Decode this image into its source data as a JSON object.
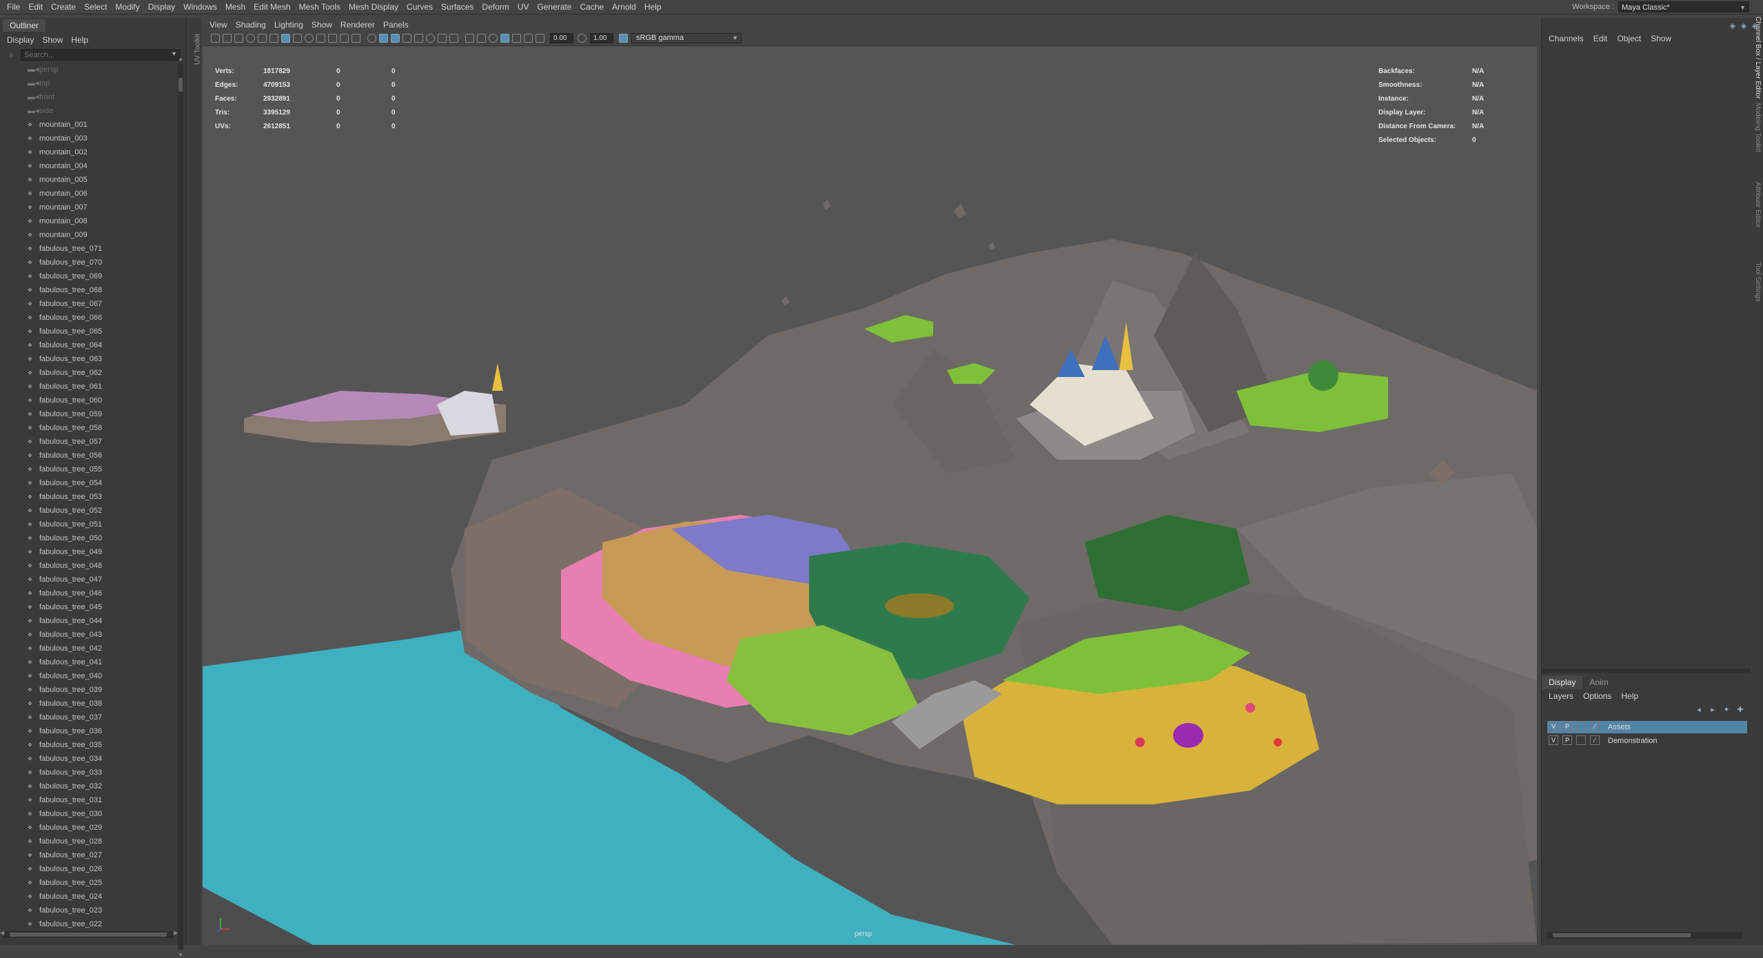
{
  "menubar": [
    "File",
    "Edit",
    "Create",
    "Select",
    "Modify",
    "Display",
    "Windows",
    "Mesh",
    "Edit Mesh",
    "Mesh Tools",
    "Mesh Display",
    "Curves",
    "Surfaces",
    "Deform",
    "UV",
    "Generate",
    "Cache",
    "Arnold",
    "Help"
  ],
  "workspace": {
    "label": "Workspace :",
    "value": "Maya Classic*"
  },
  "outliner": {
    "title": "Outliner",
    "menu": [
      "Display",
      "Show",
      "Help"
    ],
    "search_placeholder": "Search...",
    "items": [
      "persp",
      "top",
      "front",
      "side",
      "mountain_001",
      "mountain_003",
      "mountain_002",
      "mountain_004",
      "mountain_005",
      "mountain_006",
      "mountain_007",
      "mountain_008",
      "mountain_009",
      "fabulous_tree_071",
      "fabulous_tree_070",
      "fabulous_tree_069",
      "fabulous_tree_068",
      "fabulous_tree_067",
      "fabulous_tree_066",
      "fabulous_tree_065",
      "fabulous_tree_064",
      "fabulous_tree_063",
      "fabulous_tree_062",
      "fabulous_tree_061",
      "fabulous_tree_060",
      "fabulous_tree_059",
      "fabulous_tree_058",
      "fabulous_tree_057",
      "fabulous_tree_056",
      "fabulous_tree_055",
      "fabulous_tree_054",
      "fabulous_tree_053",
      "fabulous_tree_052",
      "fabulous_tree_051",
      "fabulous_tree_050",
      "fabulous_tree_049",
      "fabulous_tree_048",
      "fabulous_tree_047",
      "fabulous_tree_046",
      "fabulous_tree_045",
      "fabulous_tree_044",
      "fabulous_tree_043",
      "fabulous_tree_042",
      "fabulous_tree_041",
      "fabulous_tree_040",
      "fabulous_tree_039",
      "fabulous_tree_038",
      "fabulous_tree_037",
      "fabulous_tree_036",
      "fabulous_tree_035",
      "fabulous_tree_034",
      "fabulous_tree_033",
      "fabulous_tree_032",
      "fabulous_tree_031",
      "fabulous_tree_030",
      "fabulous_tree_029",
      "fabulous_tree_028",
      "fabulous_tree_027",
      "fabulous_tree_026",
      "fabulous_tree_025",
      "fabulous_tree_024",
      "fabulous_tree_023",
      "fabulous_tree_022"
    ],
    "camera_count": 4
  },
  "uv_toolkit_label": "UV Toolkit",
  "viewport": {
    "menu": [
      "View",
      "Shading",
      "Lighting",
      "Show",
      "Renderer",
      "Panels"
    ],
    "exposure": "0.00",
    "gamma": "1.00",
    "color_space": "sRGB gamma",
    "stats": [
      {
        "label": "Verts:",
        "v1": "1817829",
        "v2": "0",
        "v3": "0"
      },
      {
        "label": "Edges:",
        "v1": "4709153",
        "v2": "0",
        "v3": "0"
      },
      {
        "label": "Faces:",
        "v1": "2932891",
        "v2": "0",
        "v3": "0"
      },
      {
        "label": "Tris:",
        "v1": "3395129",
        "v2": "0",
        "v3": "0"
      },
      {
        "label": "UVs:",
        "v1": "2612851",
        "v2": "0",
        "v3": "0"
      }
    ],
    "info": [
      {
        "label": "Backfaces:",
        "value": "N/A"
      },
      {
        "label": "Smoothness:",
        "value": "N/A"
      },
      {
        "label": "Instance:",
        "value": "N/A"
      },
      {
        "label": "Display Layer:",
        "value": "N/A"
      },
      {
        "label": "Distance From Camera:",
        "value": "N/A"
      },
      {
        "label": "Selected Objects:",
        "value": "0"
      }
    ],
    "camera": "persp",
    "colors": {
      "water": "#3fb0c0",
      "rock": "#6e6a68",
      "grass": "#7fc03a",
      "pink": "#e77fb0",
      "sand": "#d8b23a"
    }
  },
  "channel_box": {
    "menu": [
      "Channels",
      "Edit",
      "Object",
      "Show"
    ]
  },
  "layer_editor": {
    "tabs": [
      "Display",
      "Anim"
    ],
    "menu": [
      "Layers",
      "Options",
      "Help"
    ],
    "layers": [
      {
        "v": "V",
        "p": "P",
        "name": "Assets",
        "selected": true
      },
      {
        "v": "V",
        "p": "P",
        "name": "Demonstration",
        "selected": false
      }
    ]
  },
  "side_tabs": [
    "Channel Box / Layer Editor",
    "Modeling Toolkit",
    "Attribute Editor",
    "Tool Settings"
  ]
}
